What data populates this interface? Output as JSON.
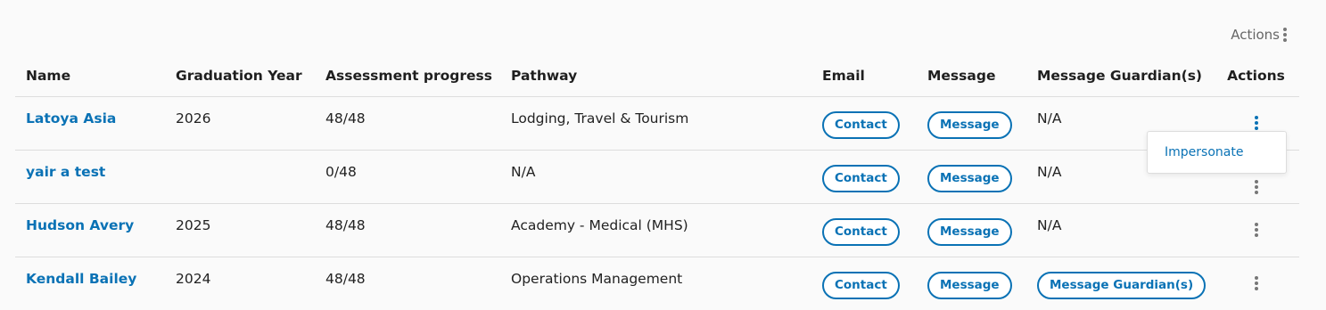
{
  "top_actions_label": "Actions",
  "headers": {
    "name": "Name",
    "grad": "Graduation Year",
    "assess": "Assessment progress",
    "pathway": "Pathway",
    "email": "Email",
    "message": "Message",
    "guardian": "Message Guardian(s)",
    "actions": "Actions"
  },
  "rows": [
    {
      "name": "Latoya Asia",
      "grad": "2026",
      "assess": "48/48",
      "pathway": "Lodging, Travel & Tourism",
      "email_btn": "Contact",
      "message_btn": "Message",
      "guardian": "N/A"
    },
    {
      "name": "yair a test",
      "grad": "",
      "assess": "0/48",
      "pathway": "N/A",
      "email_btn": "Contact",
      "message_btn": "Message",
      "guardian": "N/A"
    },
    {
      "name": "Hudson Avery",
      "grad": "2025",
      "assess": "48/48",
      "pathway": "Academy - Medical (MHS)",
      "email_btn": "Contact",
      "message_btn": "Message",
      "guardian": "N/A"
    },
    {
      "name": "Kendall Bailey",
      "grad": "2024",
      "assess": "48/48",
      "pathway": "Operations Management",
      "email_btn": "Contact",
      "message_btn": "Message",
      "guardian_btn": "Message Guardian(s)"
    }
  ],
  "dropdown": {
    "item": "Impersonate"
  },
  "icons": {
    "actions": "kebab-vertical-icon"
  },
  "colors": {
    "accent": "#0a72b5"
  }
}
